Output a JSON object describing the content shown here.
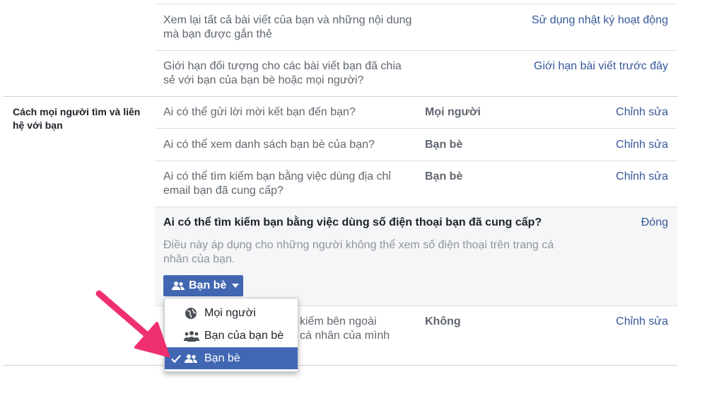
{
  "top_rows": [
    {
      "text": "Xem lại tất cả bài viết của bạn và những nội dung mà bạn được gắn thẻ",
      "action": "Sử dụng nhật ký hoạt động"
    },
    {
      "text": "Giới hạn đối tượng cho các bài viết bạn đã chia sẻ với bạn của bạn bè hoặc mọi người?",
      "action": "Giới hạn bài viết trước đây"
    }
  ],
  "section": {
    "label": "Cách mọi người tìm và liên hệ với bạn",
    "rows": [
      {
        "question": "Ai có thể gửi lời mời kết bạn đến bạn?",
        "value": "Mọi người",
        "action": "Chỉnh sửa"
      },
      {
        "question": "Ai có thể xem danh sách bạn bè của bạn?",
        "value": "Bạn bè",
        "action": "Chỉnh sửa"
      },
      {
        "question": "Ai có thể tìm kiếm bạn bằng việc dùng địa chỉ email bạn đã cung cấp?",
        "value": "Bạn bè",
        "action": "Chỉnh sửa"
      }
    ],
    "expanded": {
      "title": "Ai có thể tìm kiếm bạn bằng việc dùng số điện thoại bạn đã cung cấp?",
      "description": "Điều này áp dụng cho những người không thể xem số điện thoại trên trang cá nhân của bạn.",
      "close": "Đóng",
      "audience_button": "Bạn bè"
    },
    "last_row": {
      "question_line1": "kiếm bên ngoài",
      "question_line2": "cá nhân của mình",
      "value": "Không",
      "action": "Chỉnh sửa"
    }
  },
  "dropdown": {
    "options": [
      {
        "label": "Mọi người",
        "icon": "globe-icon"
      },
      {
        "label": "Bạn của bạn bè",
        "icon": "friends-of-friends-icon"
      },
      {
        "label": "Bạn bè",
        "icon": "friends-icon",
        "selected": true
      }
    ]
  },
  "colors": {
    "link": "#365899",
    "button_blue": "#4267b2",
    "annotation_arrow": "#f0306e"
  }
}
